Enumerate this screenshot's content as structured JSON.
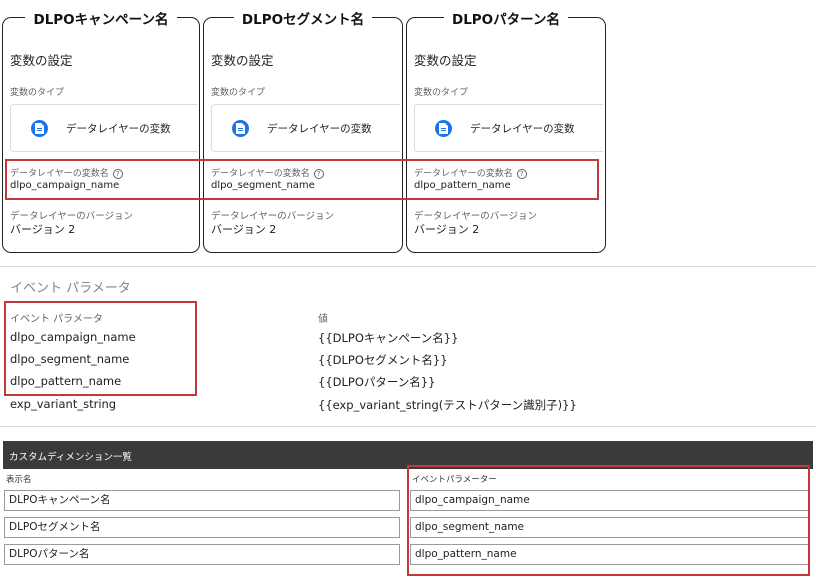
{
  "cards": [
    {
      "title": "DLPOキャンペーン名",
      "section_title": "変数の設定",
      "var_type_label": "変数のタイプ",
      "var_type_value": "データレイヤーの変数",
      "dl_name_label": "データレイヤーの変数名",
      "dl_name_value": "dlpo_campaign_name",
      "version_label": "データレイヤーのバージョン",
      "version_value": "バージョン 2"
    },
    {
      "title": "DLPOセグメント名",
      "section_title": "変数の設定",
      "var_type_label": "変数のタイプ",
      "var_type_value": "データレイヤーの変数",
      "dl_name_label": "データレイヤーの変数名",
      "dl_name_value": "dlpo_segment_name",
      "version_label": "データレイヤーのバージョン",
      "version_value": "バージョン 2"
    },
    {
      "title": "DLPOパターン名",
      "section_title": "変数の設定",
      "var_type_label": "変数のタイプ",
      "var_type_value": "データレイヤーの変数",
      "dl_name_label": "データレイヤーの変数名",
      "dl_name_value": "dlpo_pattern_name",
      "version_label": "データレイヤーのバージョン",
      "version_value": "バージョン 2"
    }
  ],
  "event_params": {
    "title": "イベント パラメータ",
    "col_name": "イベント パラメータ",
    "col_value": "値",
    "rows": [
      {
        "name": "dlpo_campaign_name",
        "value": "{{DLPOキャンペーン名}}"
      },
      {
        "name": "dlpo_segment_name",
        "value": "{{DLPOセグメント名}}"
      },
      {
        "name": "dlpo_pattern_name",
        "value": "{{DLPOパターン名}}"
      },
      {
        "name": "exp_variant_string",
        "value": "{{exp_variant_string(テストパターン識別子)}}"
      }
    ]
  },
  "custom_dimensions": {
    "header": "カスタムディメンション一覧",
    "col_display": "表示名",
    "col_param": "イベントパラメーター",
    "rows": [
      {
        "display": "DLPOキャンペーン名",
        "param": "dlpo_campaign_name"
      },
      {
        "display": "DLPOセグメント名",
        "param": "dlpo_segment_name"
      },
      {
        "display": "DLPOパターン名",
        "param": "dlpo_pattern_name"
      }
    ]
  },
  "colors": {
    "highlight": "#c0393b",
    "icon_blue": "#1a73e8",
    "header_dark": "#3a3a3a"
  },
  "icons": {
    "variable_type": "document-icon",
    "help": "help-circle-icon"
  }
}
